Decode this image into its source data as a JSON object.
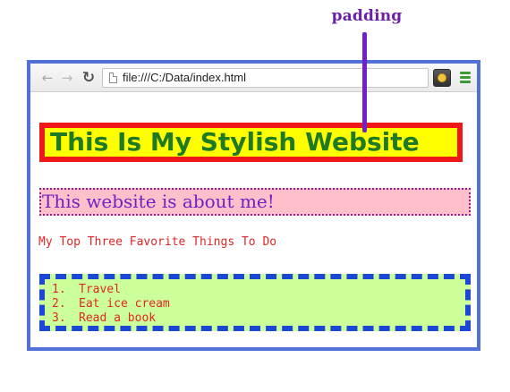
{
  "annotation": {
    "label": "padding"
  },
  "browser": {
    "address": "file:///C:/Data/index.html",
    "icons": {
      "back": "←",
      "forward": "→",
      "reload": "↻"
    }
  },
  "page": {
    "title": "This Is My Stylish Website",
    "subtitle": "This website is about me!",
    "favorites_heading": "My Top Three Favorite Things To Do",
    "favorites": [
      {
        "number": "1.",
        "text": "Travel"
      },
      {
        "number": "2.",
        "text": "Eat ice cream"
      },
      {
        "number": "3.",
        "text": "Read a book"
      }
    ]
  },
  "colors": {
    "window_border": "#5170d8",
    "annotation": "#6f22c9",
    "title_background": "#ffff00",
    "title_border": "#ef1717",
    "title_text": "#1f7a24",
    "subtitle_background": "#ffc0cb",
    "subtitle_border": "#8b1f92",
    "subtitle_text": "#6d22c6",
    "list_background": "#ccff99",
    "list_border": "#1c46d6",
    "list_text": "#e12626"
  }
}
